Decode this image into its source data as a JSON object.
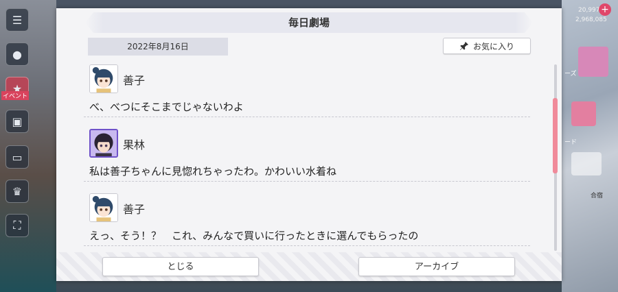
{
  "dialog": {
    "title": "毎日劇場",
    "date": "2022年8月16日",
    "favorite_label": "お気に入り",
    "messages": [
      {
        "speaker": "善子",
        "text": "べ、べつにそこまでじゃないわよ",
        "avatar": "yoshiko-avatar"
      },
      {
        "speaker": "果林",
        "text": "私は善子ちゃんに見惚れちゃったわ。かわいい水着ね",
        "avatar": "karin-avatar"
      },
      {
        "speaker": "善子",
        "text": "えっ、そう！？　これ、みんなで買いに行ったときに選んでもらったの",
        "avatar": "yoshiko-avatar"
      }
    ],
    "close_label": "とじる",
    "archive_label": "アーカイブ"
  },
  "background": {
    "currency_1": "20,997",
    "currency_2": "2,968,085",
    "event_tag": "イベント",
    "right_tag_1": "ーズ",
    "right_tag_2": "ード",
    "right_tag_3": "合宿"
  },
  "colors": {
    "scroll_thumb": "#f08a9a",
    "avatar_border_selected": "#6f52c9",
    "plus_button": "#e0476a"
  }
}
